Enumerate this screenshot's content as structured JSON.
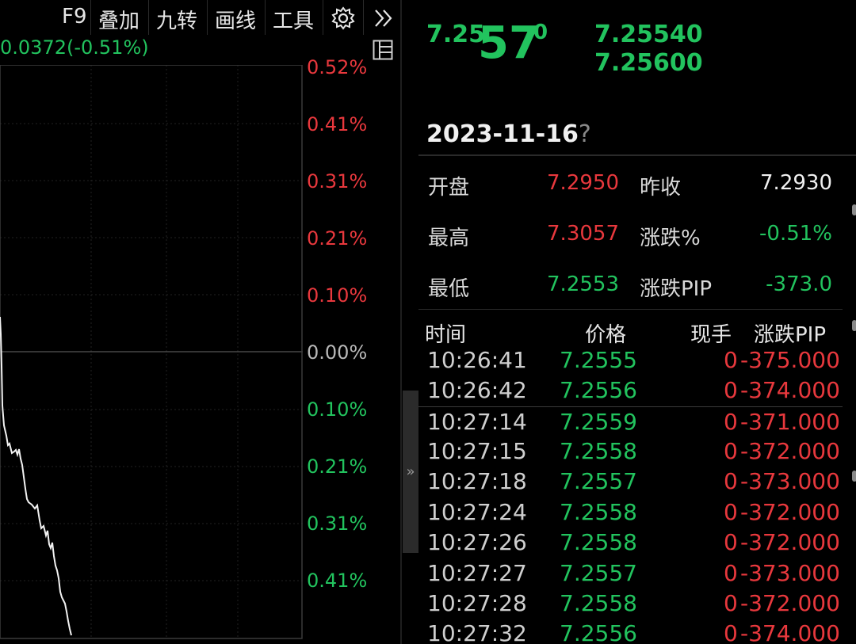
{
  "toolbar": {
    "items": [
      "F9",
      "叠加",
      "九转",
      "画线",
      "工具"
    ],
    "settings_icon": "gear-icon",
    "more_icon": "chevron-double-right-icon"
  },
  "chart": {
    "change_readout": "0.0372(-0.51%)",
    "layout_icon": "panel-layout-icon",
    "pct_labels": [
      {
        "text": "0.52%",
        "color": "#e8383d"
      },
      {
        "text": "0.41%",
        "color": "#e8383d"
      },
      {
        "text": "0.31%",
        "color": "#e8383d"
      },
      {
        "text": "0.21%",
        "color": "#e8383d"
      },
      {
        "text": "0.10%",
        "color": "#e8383d"
      },
      {
        "text": "0.00%",
        "color": "#b8b8b8"
      },
      {
        "text": "0.10%",
        "color": "#22c35e"
      },
      {
        "text": "0.21%",
        "color": "#22c35e"
      },
      {
        "text": "0.31%",
        "color": "#22c35e"
      },
      {
        "text": "0.41%",
        "color": "#22c35e"
      }
    ]
  },
  "collapse_handle": {
    "glyph": "»"
  },
  "quote": {
    "price_main_prefix": "7.25",
    "price_main_big": "57",
    "price_main_sup": "0",
    "bid": "7.25540",
    "ask": "7.25600",
    "date": "2023-11-16",
    "date_suffix": "?",
    "stats": [
      {
        "label": "开盘",
        "value": "7.2950",
        "color": "#e8383d"
      },
      {
        "label": "昨收",
        "value": "7.2930",
        "color": "#f0f0f0"
      },
      {
        "label": "最高",
        "value": "7.3057",
        "color": "#e8383d"
      },
      {
        "label": "涨跌%",
        "value": "-0.51%",
        "color": "#22c35e"
      },
      {
        "label": "最低",
        "value": "7.2553",
        "color": "#22c35e"
      },
      {
        "label": "涨跌PIP",
        "value": "-373.0",
        "color": "#22c35e"
      }
    ]
  },
  "ticks": {
    "headers": {
      "time": "时间",
      "price": "价格",
      "vol": "现手",
      "chg": "涨跌PIP"
    },
    "rows": [
      {
        "time": "10:26:41",
        "price": "7.2555",
        "vol": "0",
        "chg": "-375.000"
      },
      {
        "time": "10:26:42",
        "price": "7.2556",
        "vol": "0",
        "chg": "-374.000"
      },
      {
        "time": "10:27:14",
        "price": "7.2559",
        "vol": "0",
        "chg": "-371.000"
      },
      {
        "time": "10:27:15",
        "price": "7.2558",
        "vol": "0",
        "chg": "-372.000"
      },
      {
        "time": "10:27:18",
        "price": "7.2557",
        "vol": "0",
        "chg": "-373.000"
      },
      {
        "time": "10:27:24",
        "price": "7.2558",
        "vol": "0",
        "chg": "-372.000"
      },
      {
        "time": "10:27:26",
        "price": "7.2558",
        "vol": "0",
        "chg": "-372.000"
      },
      {
        "time": "10:27:27",
        "price": "7.2557",
        "vol": "0",
        "chg": "-373.000"
      },
      {
        "time": "10:27:28",
        "price": "7.2558",
        "vol": "0",
        "chg": "-372.000"
      },
      {
        "time": "10:27:32",
        "price": "7.2556",
        "vol": "0",
        "chg": "-374.000"
      }
    ]
  }
}
